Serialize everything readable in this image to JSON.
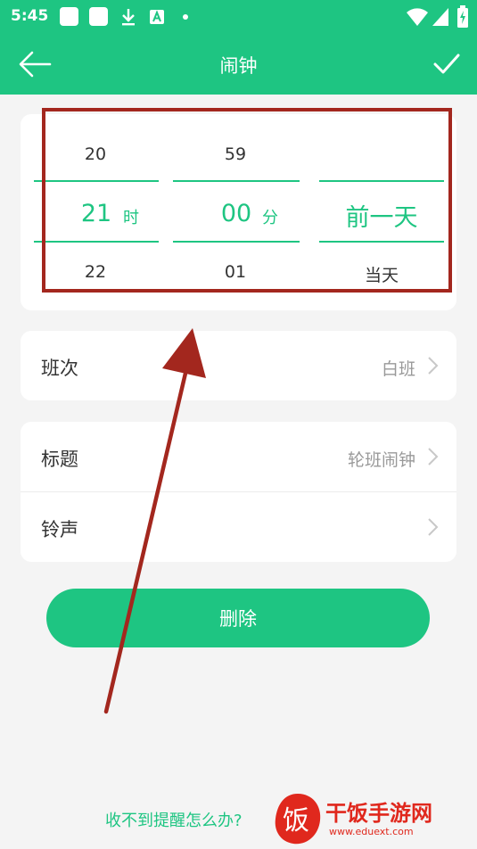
{
  "status": {
    "time": "5:45"
  },
  "appbar": {
    "title": "闹钟"
  },
  "picker": {
    "hours": {
      "prev": "20",
      "current": "21",
      "next": "22",
      "unit": "时"
    },
    "minutes": {
      "prev": "59",
      "current": "00",
      "next": "01",
      "unit": "分"
    },
    "day": {
      "prev": "",
      "current": "前一天",
      "next": "当天"
    }
  },
  "shift": {
    "label": "班次",
    "value": "白班"
  },
  "title_row": {
    "label": "标题",
    "value": "轮班闹钟"
  },
  "ringtone": {
    "label": "铃声",
    "value": ""
  },
  "delete_label": "删除",
  "help_link": "收不到提醒怎么办?",
  "watermark": {
    "logo_text": "干饭手游网",
    "url": "www.eduext.com"
  },
  "colors": {
    "primary": "#1ec582",
    "annotation": "#a3271e"
  }
}
